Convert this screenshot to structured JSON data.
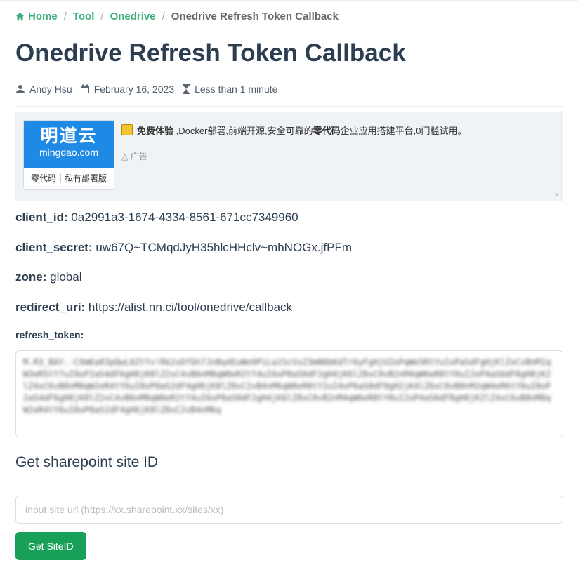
{
  "breadcrumb": {
    "items": [
      "Home",
      "Tool",
      "Onedrive"
    ],
    "current": "Onedrive Refresh Token Callback",
    "separator": "/"
  },
  "page": {
    "title": "Onedrive Refresh Token Callback",
    "author": "Andy Hsu",
    "date": "February 16, 2023",
    "read_time": "Less than 1 minute"
  },
  "ad": {
    "logo_cn": "明道云",
    "logo_url": "mingdao.com",
    "logo_tagline": "零代码｜私有部署版",
    "text_bold1": "免费体验",
    "text_part1": " ,Docker部署,前端开源,安全可靠的",
    "text_bold2": "零代码",
    "text_part2": "企业应用搭建平台,0门槛试用。",
    "label": "广告",
    "close": "×"
  },
  "fields": {
    "client_id_label": "client_id:",
    "client_id_value": " 0a2991a3-1674-4334-8561-671cc7349960",
    "client_secret_label": "client_secret:",
    "client_secret_value": " uw67Q~TCMqdJyH35hlcHHclv~mhNOGx.jfPFm",
    "zone_label": "zone:",
    "zone_value": " global",
    "redirect_label": "redirect_uri:",
    "redirect_value": " https://alist.nn.ci/tool/onedrive/callback",
    "refresh_token_label": "refresh_token:"
  },
  "token": {
    "value": "M.R3_BAY.-CXmKa83pQwL0ZtYv!Rk2sDfGh7JnBq4EuWo9PiLa1ScVxZ3mN8bKdTr6yFgHjU2oPqWe5RtYuIoPaSdFgHjKlZxCvBnM1qW3eR5tY7uI9oP2aS4dF6gH8jK0lZ2xC4vB6nM8qW0eR2tY4uI6oP8aS0dF2gH4jK6lZ8xC0vB2nM4qW6eR8tY0uI2oP4aS6dF8gH0jK2lZ4xC6vB8nM0qW2eR4tY6uI8oP0aS2dF4gH6jK8lZ0xC2vB4nM6qW8eR0tY2uI4oP6aS8dF0gH2jK4lZ6xC8vB0nM2qW4eR6tY8uI0oP2aS4dF6gH8jK0lZ2xC4vB6nM8qW0eR2tY4uI6oP8aS0dF2gH4jK6lZ8xC0vB2nM4qW6eR8tY0uI2oP4aS6dF8gH0jK2lZ4xC6vB8nM0qW2eR4tY6uI8oP0aS2dF4gH6jK8lZ0xC2vB4nM6q"
  },
  "sharepoint": {
    "heading": "Get sharepoint site ID",
    "placeholder": "input site url (https://xx.sharepoint.xx/sites/xx)",
    "button": "Get SiteID"
  },
  "colors": {
    "accent": "#3eaf7c",
    "button": "#18a058",
    "ad_logo": "#1f89e6"
  },
  "icons": [
    "home-icon",
    "user-icon",
    "calendar-icon",
    "hourglass-icon",
    "ad-icon",
    "close-icon"
  ]
}
